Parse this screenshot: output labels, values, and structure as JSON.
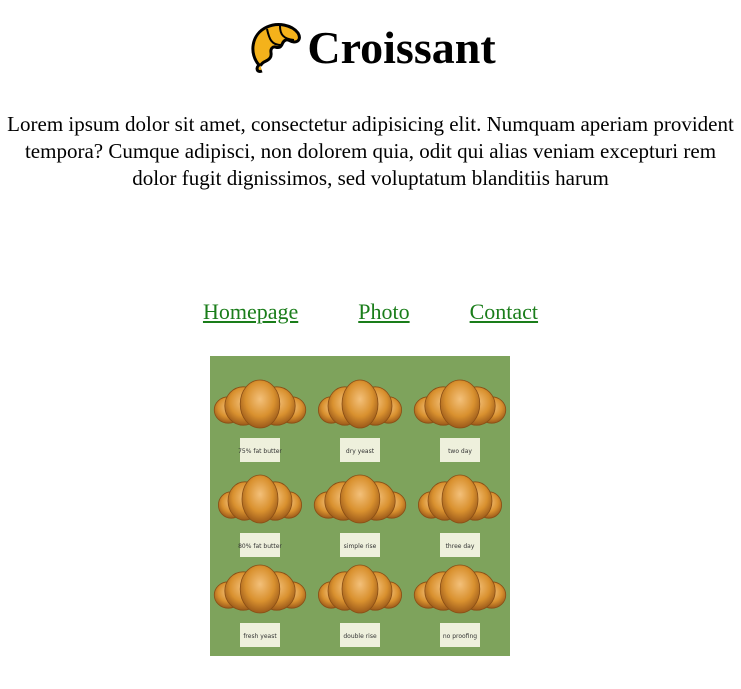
{
  "header": {
    "title": "Croissant",
    "logo_icon": "croissant-icon"
  },
  "intro": {
    "text": "Lorem ipsum dolor sit amet, consectetur adipisicing elit. Numquam aperiam provident tempora? Cumque adipisci, non dolorem quia, odit qui alias veniam excepturi rem dolor fugit dignissimos, sed voluptatum blanditiis harum"
  },
  "nav": {
    "items": [
      {
        "label": "Homepage"
      },
      {
        "label": "Photo"
      },
      {
        "label": "Contact"
      }
    ]
  },
  "photo": {
    "subject": "croissants-grid",
    "background_color": "#7ea35c",
    "labels": [
      "75% fat butter",
      "dry yeast",
      "two day",
      "80% fat butter",
      "simple rise",
      "three day",
      "fresh yeast",
      "double rise",
      "no proofing"
    ]
  },
  "colors": {
    "link": "#1a7d1a",
    "logo_fill": "#f4b21b"
  }
}
